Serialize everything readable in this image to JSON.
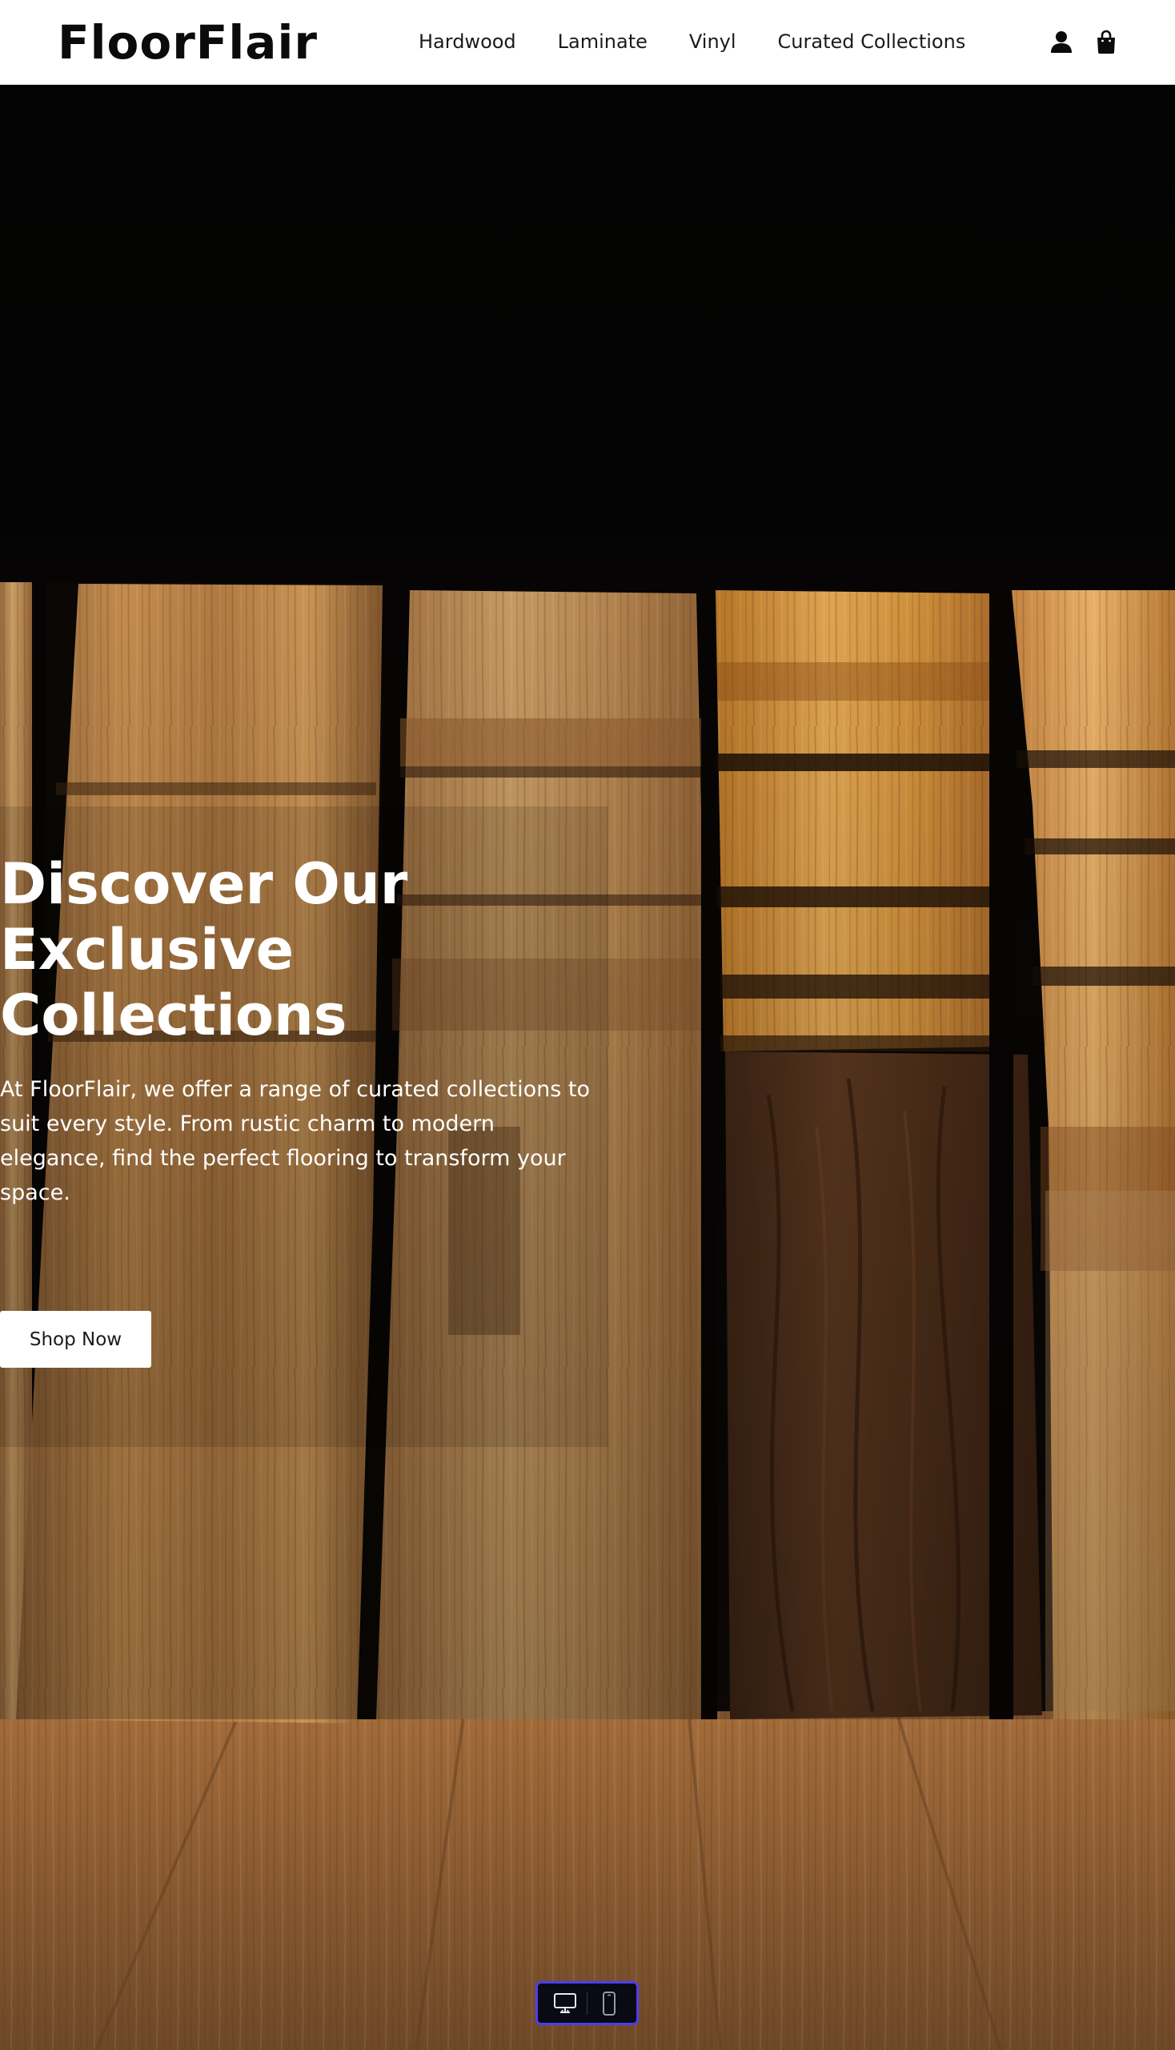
{
  "brand": {
    "name": "FloorFlair"
  },
  "nav": {
    "items": [
      {
        "label": "Hardwood"
      },
      {
        "label": "Laminate"
      },
      {
        "label": "Vinyl"
      },
      {
        "label": "Curated Collections"
      }
    ]
  },
  "header_icons": {
    "account": "user-icon",
    "cart": "shopping-bag-icon"
  },
  "hero": {
    "title": "Discover Our\nExclusive\nCollections",
    "description": "At FloorFlair, we offer a range of curated collections to suit every style. From rustic charm to modern elegance, find the perfect flooring to transform your space.",
    "cta_label": "Shop Now",
    "background": "wood-flooring-samples-photo"
  },
  "device_toggle": {
    "options": [
      "desktop-icon",
      "mobile-icon"
    ],
    "accent": "#4b3df0"
  },
  "colors": {
    "header_bg": "#ffffff",
    "text_dark": "#1b1b1b",
    "hero_text": "#ffffff",
    "button_bg": "#ffffff"
  }
}
